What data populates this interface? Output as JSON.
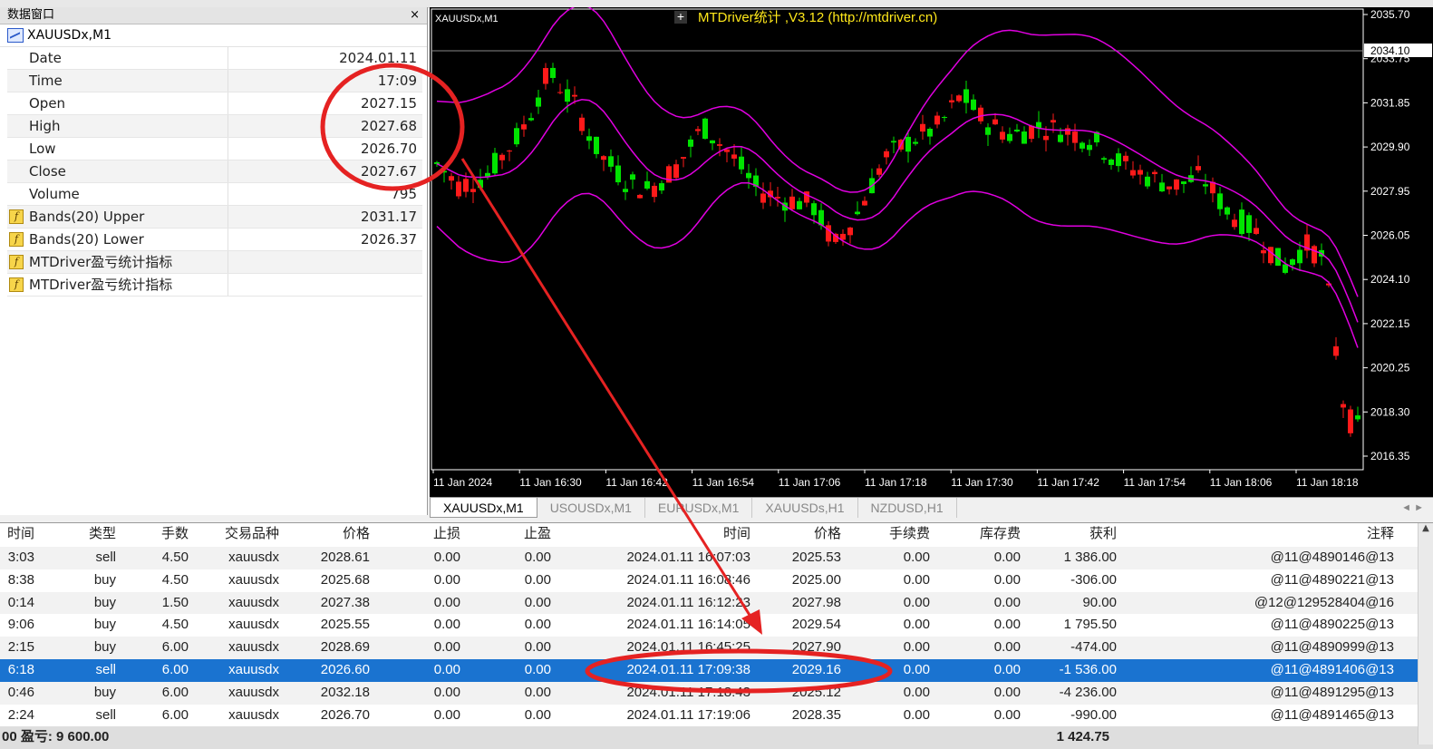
{
  "data_window": {
    "title": "数据窗口",
    "close": "×",
    "symbol": "XAUUSDx,M1",
    "rows": [
      {
        "key": "Date",
        "value": "2024.01.11"
      },
      {
        "key": "Time",
        "value": "17:09"
      },
      {
        "key": "Open",
        "value": "2027.15"
      },
      {
        "key": "High",
        "value": "2027.68"
      },
      {
        "key": "Low",
        "value": "2026.70"
      },
      {
        "key": "Close",
        "value": "2027.67"
      },
      {
        "key": "Volume",
        "value": "795"
      },
      {
        "key": "Bands(20) Upper",
        "value": "2031.17",
        "icon": "function-icon"
      },
      {
        "key": "Bands(20) Lower",
        "value": "2026.37",
        "icon": "function-icon"
      },
      {
        "key": "MTDriver盈亏统计指标",
        "value": "",
        "icon": "function-icon"
      },
      {
        "key": "MTDriver盈亏统计指标",
        "value": "",
        "icon": "function-icon"
      }
    ]
  },
  "chart": {
    "symbol_label": "XAUUSDx,M1",
    "ea_title": "MTDriver统计 ,V3.12 (http://mtdriver.cn)",
    "current_price": "2034.10",
    "price_ticks": [
      "2035.70",
      "2033.75",
      "2031.85",
      "2029.90",
      "2027.95",
      "2026.05",
      "2024.10",
      "2022.15",
      "2020.25",
      "2018.30",
      "2016.35"
    ],
    "time_ticks": [
      "11 Jan 2024",
      "11 Jan 16:30",
      "11 Jan 16:42",
      "11 Jan 16:54",
      "11 Jan 17:06",
      "11 Jan 17:18",
      "11 Jan 17:30",
      "11 Jan 17:42",
      "11 Jan 17:54",
      "11 Jan 18:06",
      "11 Jan 18:18"
    ],
    "colors": {
      "bull": "#00e400",
      "bear": "#ff1a1a",
      "bands": "#e000e0",
      "background": "#000000"
    }
  },
  "tabs": [
    "XAUUSDx,M1",
    "USOUSDx,M1",
    "EURUSDx,M1",
    "XAUUSDs,H1",
    "NZDUSD,H1"
  ],
  "trades": {
    "headers": [
      "时间",
      "类型",
      "手数",
      "交易品种",
      "价格",
      "止损",
      "止盈",
      "时间",
      "价格",
      "手续费",
      "库存费",
      "获利",
      "注释"
    ],
    "rows": [
      [
        "3:03",
        "sell",
        "4.50",
        "xauusdx",
        "2028.61",
        "0.00",
        "0.00",
        "2024.01.11 16:07:03",
        "2025.53",
        "0.00",
        "0.00",
        "1 386.00",
        "@11@4890146@13"
      ],
      [
        "8:38",
        "buy",
        "4.50",
        "xauusdx",
        "2025.68",
        "0.00",
        "0.00",
        "2024.01.11 16:08:46",
        "2025.00",
        "0.00",
        "0.00",
        "-306.00",
        "@11@4890221@13"
      ],
      [
        "0:14",
        "buy",
        "1.50",
        "xauusdx",
        "2027.38",
        "0.00",
        "0.00",
        "2024.01.11 16:12:23",
        "2027.98",
        "0.00",
        "0.00",
        "90.00",
        "@12@129528404@16"
      ],
      [
        "9:06",
        "buy",
        "4.50",
        "xauusdx",
        "2025.55",
        "0.00",
        "0.00",
        "2024.01.11 16:14:05",
        "2029.54",
        "0.00",
        "0.00",
        "1 795.50",
        "@11@4890225@13"
      ],
      [
        "2:15",
        "buy",
        "6.00",
        "xauusdx",
        "2028.69",
        "0.00",
        "0.00",
        "2024.01.11 16:45:25",
        "2027.90",
        "0.00",
        "0.00",
        "-474.00",
        "@11@4890999@13"
      ],
      [
        "6:18",
        "sell",
        "6.00",
        "xauusdx",
        "2026.60",
        "0.00",
        "0.00",
        "2024.01.11 17:09:38",
        "2029.16",
        "0.00",
        "0.00",
        "-1 536.00",
        "@11@4891406@13"
      ],
      [
        "0:46",
        "buy",
        "6.00",
        "xauusdx",
        "2032.18",
        "0.00",
        "0.00",
        "2024.01.11 17:18:43",
        "2025.12",
        "0.00",
        "0.00",
        "-4 236.00",
        "@11@4891295@13"
      ],
      [
        "2:24",
        "sell",
        "6.00",
        "xauusdx",
        "2026.70",
        "0.00",
        "0.00",
        "2024.01.11 17:19:06",
        "2028.35",
        "0.00",
        "0.00",
        "-990.00",
        "@11@4891465@13"
      ]
    ],
    "selected_row": 5,
    "summary": {
      "label": "00  盈亏: 9 600.00",
      "total": "1 424.75"
    }
  }
}
